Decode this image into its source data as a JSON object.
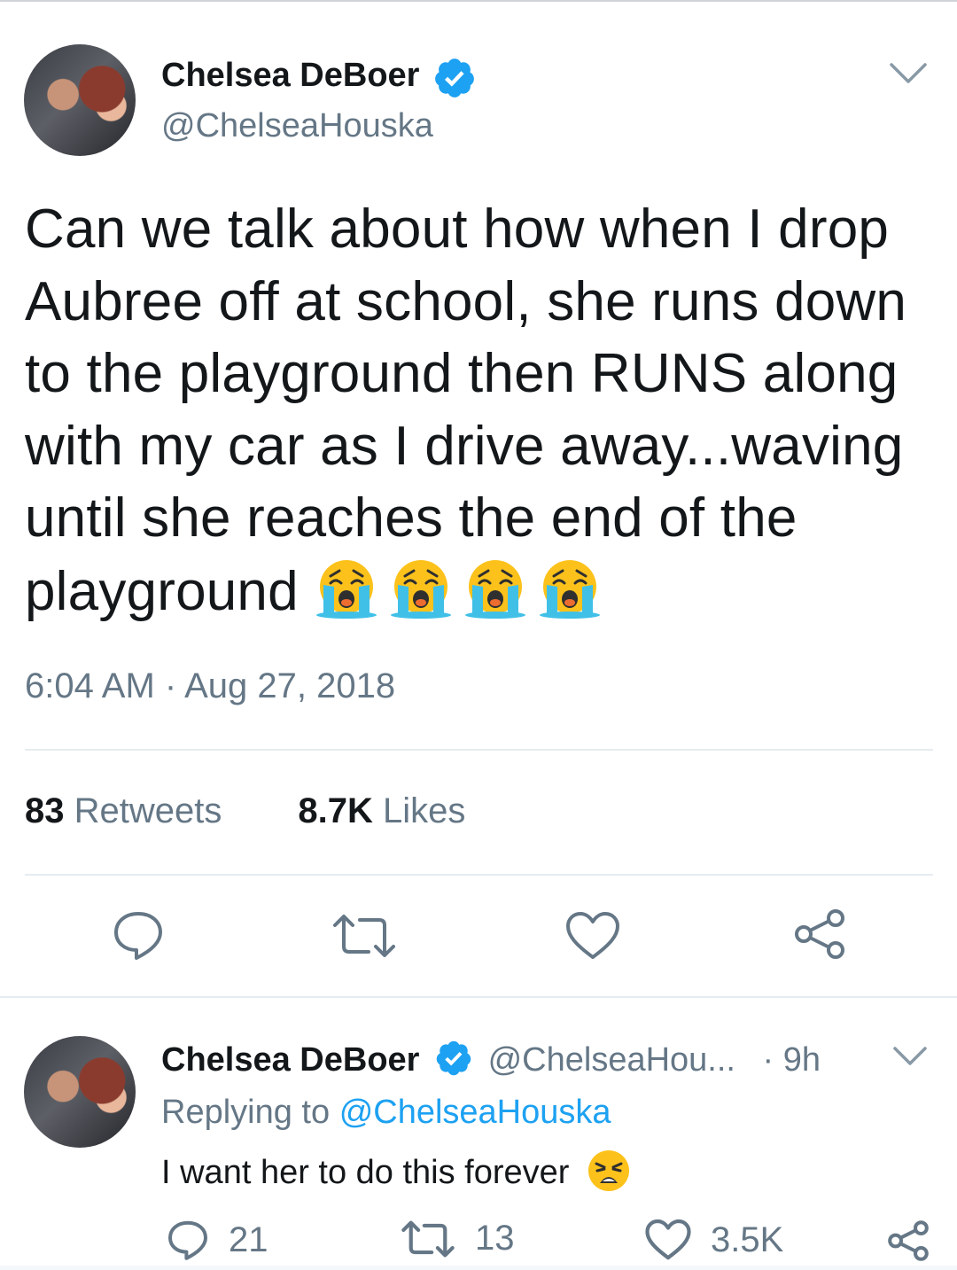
{
  "tweet": {
    "author_name": "Chelsea DeBoer",
    "handle": "@ChelseaHouska",
    "text": "Can we talk about how when I drop Aubree off at school, she runs down to the playground then RUNS along with my car as I drive away...waving until she reaches the end of the playground",
    "emoji": [
      "loudly-crying-face",
      "loudly-crying-face",
      "loudly-crying-face",
      "loudly-crying-face"
    ],
    "timestamp": "6:04 AM · Aug 27, 2018",
    "retweets_count": "83",
    "retweets_label": "Retweets",
    "likes_count": "8.7K",
    "likes_label": "Likes"
  },
  "reply": {
    "author_name": "Chelsea DeBoer",
    "handle": "@ChelseaHou...",
    "time": "· 9h",
    "replying_prefix": "Replying to",
    "replying_to": "@ChelseaHouska",
    "text": "I want her to do this forever",
    "emoji": "weary-face",
    "reply_count": "21",
    "retweet_count": "13",
    "like_count": "3.5K"
  },
  "colors": {
    "text": "#14171a",
    "secondary": "#657786",
    "link": "#1da1f2",
    "verified": "#1da1f2",
    "divider": "#e6ecf0"
  }
}
